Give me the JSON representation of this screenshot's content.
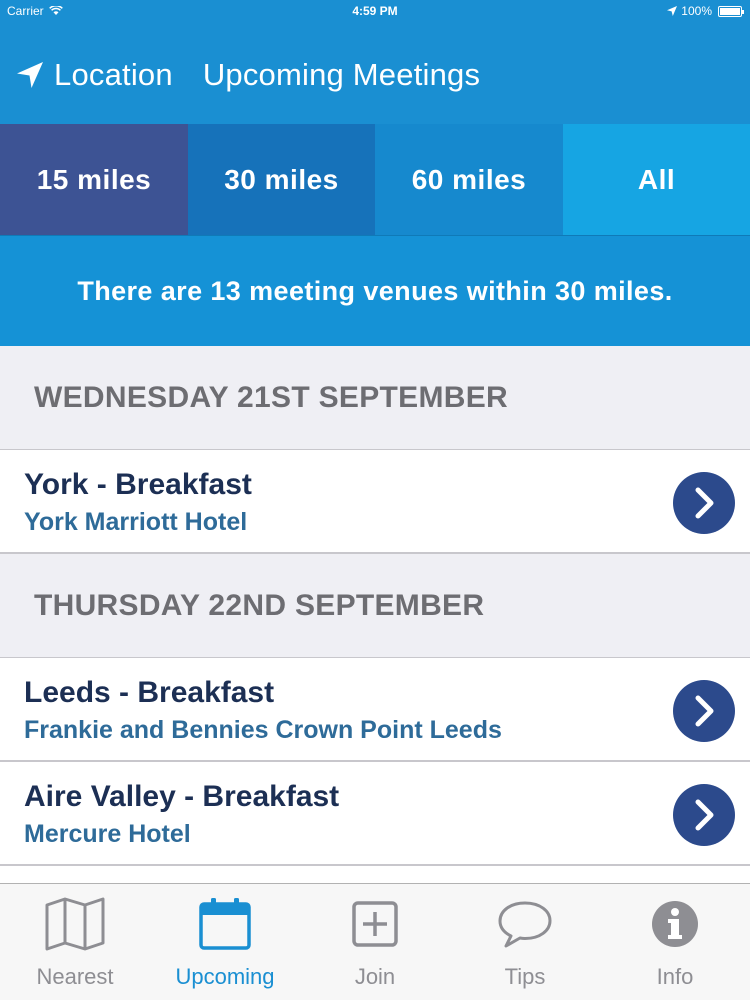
{
  "status_bar": {
    "carrier": "Carrier",
    "time": "4:59 PM",
    "battery": "100%"
  },
  "nav": {
    "location_label": "Location",
    "title": "Upcoming Meetings"
  },
  "distance_tabs": [
    {
      "label": "15 miles"
    },
    {
      "label": "30 miles"
    },
    {
      "label": "60 miles"
    },
    {
      "label": "All"
    }
  ],
  "banner": {
    "text": "There are 13 meeting venues within 30 miles."
  },
  "sections": [
    {
      "header": "WEDNESDAY 21ST SEPTEMBER",
      "rows": [
        {
          "name": "York - Breakfast",
          "venue": "York Marriott Hotel"
        }
      ]
    },
    {
      "header": "THURSDAY 22ND SEPTEMBER",
      "rows": [
        {
          "name": "Leeds - Breakfast",
          "venue": "Frankie and Bennies Crown Point Leeds"
        },
        {
          "name": "Aire Valley - Breakfast",
          "venue": "Mercure Hotel"
        }
      ]
    }
  ],
  "tab_bar": [
    {
      "label": "Nearest",
      "icon": "map-icon"
    },
    {
      "label": "Upcoming",
      "icon": "calendar-icon",
      "active": true
    },
    {
      "label": "Join",
      "icon": "plus-square-icon"
    },
    {
      "label": "Tips",
      "icon": "speech-bubble-icon"
    },
    {
      "label": "Info",
      "icon": "info-icon"
    }
  ],
  "colors": {
    "header_blue": "#1a8fd2",
    "tab_selected": "#3d5394",
    "chevron_navy": "#2c4a8c",
    "tabbar_active": "#1a8fd2"
  }
}
